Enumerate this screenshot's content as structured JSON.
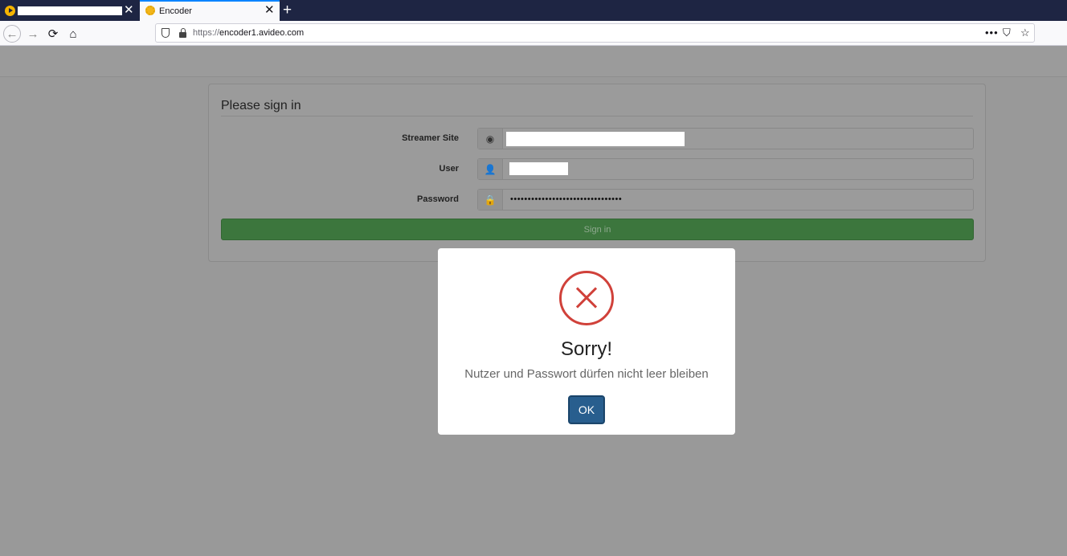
{
  "browser": {
    "tabs": [
      {
        "title": "",
        "close": "✕"
      },
      {
        "title": "Encoder",
        "close": "✕"
      }
    ],
    "new_tab": "+",
    "url_scheme": "https://",
    "url_rest": "encoder1.avideo.com",
    "url_actions": {
      "more": "•••",
      "pocket": "⛉",
      "star": "☆"
    },
    "nav": {
      "back": "←",
      "forward": "→",
      "reload": "⟳",
      "home": "⌂"
    }
  },
  "signin": {
    "title": "Please sign in",
    "fields": [
      {
        "label": "Streamer Site",
        "icon": "globe-icon",
        "value": ""
      },
      {
        "label": "User",
        "icon": "user-icon",
        "value": ""
      },
      {
        "label": "Password",
        "icon": "lock-icon",
        "value": "••••••••••••••••••••••••••••••••"
      }
    ],
    "button": "Sign in",
    "button_color": "#3c763d"
  },
  "modal": {
    "icon": "error-x-icon",
    "title": "Sorry!",
    "message": "Nutzer und Passwort dürfen nicht leer bleiben",
    "ok": "OK",
    "error_color": "#d0413a",
    "ok_color": "#285e8e"
  }
}
